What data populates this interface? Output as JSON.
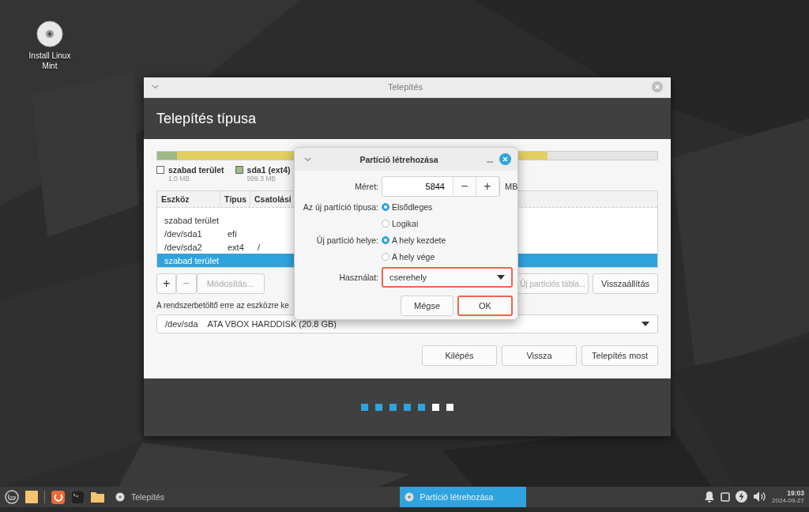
{
  "desktop_icons": [
    {
      "label": "Install Linux Mint"
    }
  ],
  "installer": {
    "title": "Telepítés",
    "heading": "Telepítés típusa",
    "partition_bar": [
      {
        "color": "#9cb986",
        "level": 0.04
      },
      {
        "color": "#e3cf62",
        "level": 0.78
      }
    ],
    "legend": [
      {
        "name": "szabad terület",
        "size": "1.0 MB",
        "color": "#ffffff"
      },
      {
        "name": "sda1 (ext4)",
        "size": "999.3 MB",
        "color": "#9cb986"
      }
    ],
    "table": {
      "columns": [
        "Eszköz",
        "Típus",
        "Csatolási"
      ],
      "rows": [
        {
          "cells": [
            "szabad terület",
            "",
            ""
          ],
          "selected": false
        },
        {
          "cells": [
            "/dev/sda1",
            "efi",
            ""
          ],
          "selected": false
        },
        {
          "cells": [
            "/dev/sda2",
            "ext4",
            "/"
          ],
          "selected": false
        },
        {
          "cells": [
            "szabad terület",
            "",
            ""
          ],
          "selected": true
        }
      ]
    },
    "table_buttons": [
      {
        "label": "+",
        "disabled": false
      },
      {
        "label": "−",
        "disabled": true
      },
      {
        "label": "Módosítás...",
        "disabled": true
      }
    ],
    "table_buttons_right": [
      {
        "label": "Új partíciós tábla...",
        "disabled": true
      },
      {
        "label": "Visszaállítás",
        "disabled": false
      }
    ],
    "bootloader": {
      "label": "A rendszerbetöltő erre az eszközre ke",
      "device": "/dev/sda",
      "description": "ATA VBOX HARDDISK (20.8 GB)"
    },
    "nav_buttons": [
      "Kilépés",
      "Vissza",
      "Telepítés most"
    ],
    "steps": [
      {
        "done": true
      },
      {
        "done": true
      },
      {
        "done": true
      },
      {
        "done": true
      },
      {
        "done": true
      },
      {
        "done": false
      },
      {
        "done": false
      }
    ]
  },
  "dialog": {
    "title": "Partíció létrehozása",
    "size": {
      "label": "Méret:",
      "value": "5844",
      "minus": "−",
      "plus": "+",
      "unit": "MB"
    },
    "radio_groups": [
      {
        "label": "Az új partíció típusa:",
        "options": [
          {
            "label": "Elsődleges",
            "selected": true
          },
          {
            "label": "Logikai",
            "selected": false
          }
        ]
      },
      {
        "label": "Új partíció helye:",
        "options": [
          {
            "label": "A hely kezdete",
            "selected": true
          },
          {
            "label": "A hely vége",
            "selected": false
          }
        ]
      }
    ],
    "usage": {
      "label": "Használat:",
      "value": "cserehely",
      "highlighted": true
    },
    "buttons": [
      {
        "label": "Mégse",
        "highlighted": false
      },
      {
        "label": "OK",
        "highlighted": true
      }
    ]
  },
  "taskbar": {
    "windows": [
      {
        "label": "Telepítés",
        "selected": false
      },
      {
        "label": "Partíció létrehozása",
        "selected": true
      }
    ],
    "time": "19:03",
    "date": "2024-09-27"
  }
}
